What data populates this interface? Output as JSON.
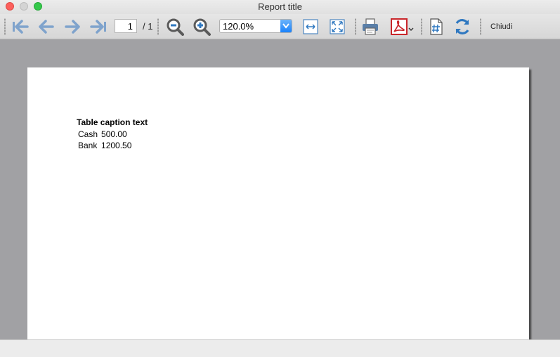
{
  "window": {
    "title": "Report title"
  },
  "toolbar": {
    "icons": {
      "first_page": "arrow-left-bar-icon",
      "prev_page": "arrow-left-icon",
      "next_page": "arrow-right-icon",
      "last_page": "arrow-right-bar-icon",
      "zoom_out": "zoom-out-icon",
      "zoom_in": "zoom-in-icon",
      "fit_width": "fit-width-icon",
      "fit_page": "fit-page-icon",
      "print": "printer-icon",
      "export_pdf": "pdf-icon",
      "page_numbers": "document-hash-icon",
      "reload": "reload-icon"
    },
    "page_current": "1",
    "page_total": "/ 1",
    "zoom": "120.0%",
    "close_label": "Chiudi"
  },
  "report": {
    "caption": "Table caption text",
    "rows": [
      {
        "account": "Cash",
        "amount": "500.00"
      },
      {
        "account": "Bank",
        "amount": "1200.50"
      }
    ]
  },
  "colors": {
    "nav_arrow": "#7fa3cc",
    "zoom_icon": "#5a5a5a",
    "accent_blue": "#2f78c0",
    "pdf_red": "#c9262a",
    "viewer_background": "#a1a1a4"
  }
}
